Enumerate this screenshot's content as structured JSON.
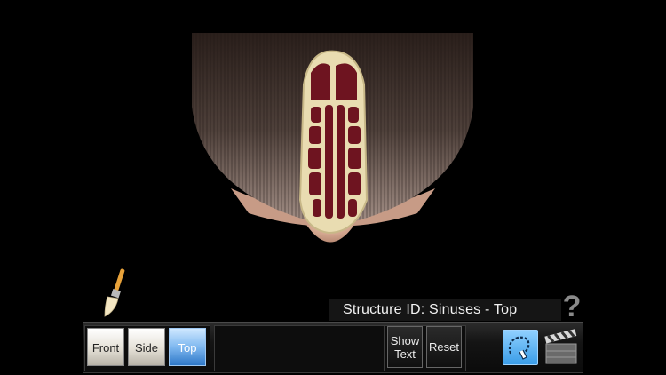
{
  "label": {
    "structure": "Structure ID: Sinuses - Top"
  },
  "views": [
    {
      "label": "Front",
      "active": false
    },
    {
      "label": "Side",
      "active": false
    },
    {
      "label": "Top",
      "active": true
    }
  ],
  "actions": {
    "show_text": "Show\nText",
    "reset": "Reset"
  },
  "help": {
    "symbol": "?"
  },
  "icons": {
    "brush": "paintbrush-icon",
    "draw": "lasso-draw-icon",
    "film": "clapperboard-icon",
    "help": "question-mark-icon"
  },
  "colors": {
    "background": "#000000",
    "active_view": "#2f78c8",
    "bone": "#e9dcb1",
    "sinus": "#6e1420"
  }
}
